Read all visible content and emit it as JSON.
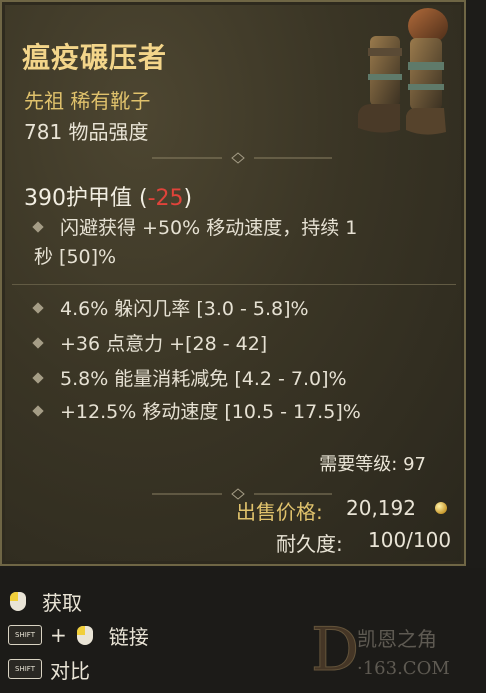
{
  "item": {
    "name": "瘟疫碾压者",
    "rarity": "先祖 稀有靴子",
    "power": "781 物品强度",
    "armor_value": "390护甲值",
    "armor_delta": "-25",
    "implicit": {
      "line1": "闪避获得 +50% 移动速度，持续 1",
      "line2": "秒 [50]%"
    },
    "affixes": [
      "4.6% 躲闪几率 [3.0 - 5.8]%",
      "+36 点意力 +[28 - 42]",
      "5.8% 能量消耗减免 [4.2 - 7.0]%",
      "+12.5% 移动速度 [10.5 - 17.5]%"
    ],
    "required_level": "需要等级: 97",
    "sell_label": "出售价格:",
    "sell_value": "20,192",
    "durability_label": "耐久度:",
    "durability_value": "100/100"
  },
  "hints": {
    "acquire": "获取",
    "link": "链接",
    "compare": "对比",
    "shift_key": "SHIFT"
  },
  "watermark": {
    "brand": "凯恩之角",
    "domain": "·163.COM"
  },
  "colors": {
    "title": "#f3d58a",
    "rarity": "#e0c26c",
    "negative": "#e0433a"
  }
}
